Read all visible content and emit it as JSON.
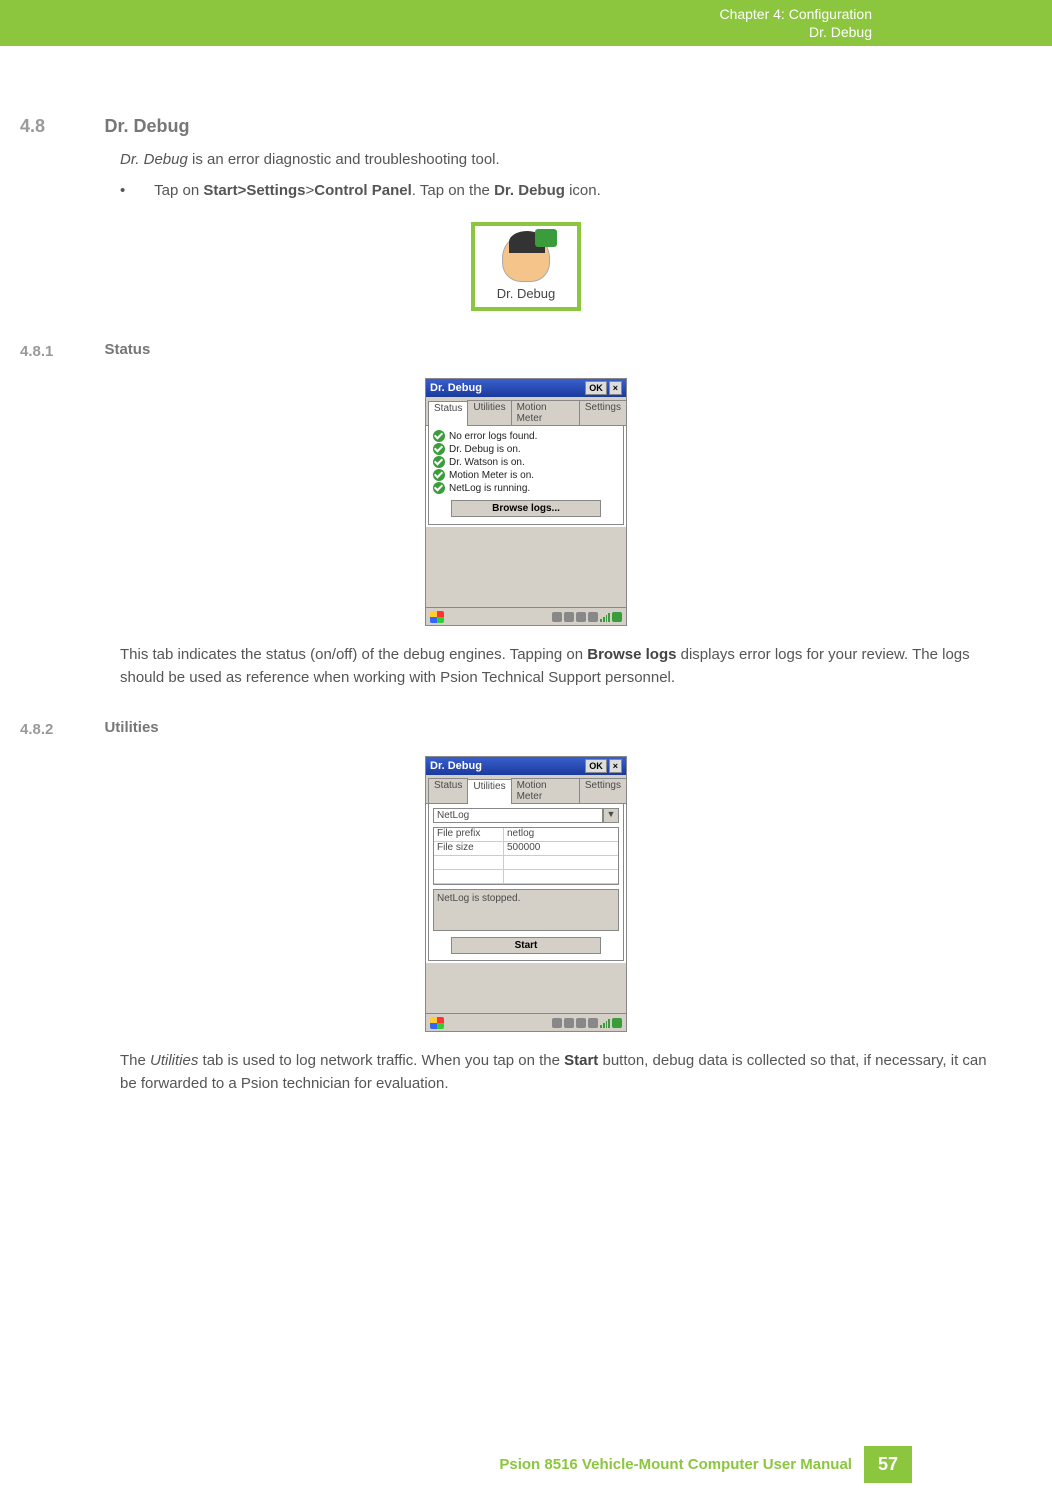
{
  "header": {
    "chapter": "Chapter 4:  Configuration",
    "subtitle": "Dr. Debug"
  },
  "sections": {
    "s48": {
      "num": "4.8",
      "title": "Dr. Debug"
    },
    "s481": {
      "num": "4.8.1",
      "title": "Status"
    },
    "s482": {
      "num": "4.8.2",
      "title": "Utilities"
    }
  },
  "intro": {
    "line1_em": "Dr. Debug",
    "line1_rest": " is an error diagnostic and troubleshooting tool.",
    "bullet_pre": "Tap on ",
    "bullet_b1": "Start>Settings",
    "bullet_mid": ">",
    "bullet_b2": "Control Panel",
    "bullet_post1": ". Tap on the ",
    "bullet_b3": "Dr. Debug",
    "bullet_post2": " icon."
  },
  "icon": {
    "label": "Dr. Debug"
  },
  "win_common": {
    "title": "Dr. Debug",
    "ok": "OK",
    "close": "×",
    "tabs": {
      "status": "Status",
      "utilities": "Utilities",
      "motion": "Motion Meter",
      "settings": "Settings"
    }
  },
  "status_win": {
    "items": [
      "No error logs found.",
      "Dr. Debug is on.",
      "Dr. Watson is on.",
      "Motion Meter is on.",
      "NetLog is running."
    ],
    "browse": "Browse logs..."
  },
  "status_para": {
    "p1": "This tab indicates the status (on/off) of the debug engines. Tapping on ",
    "b1": "Browse logs",
    "p2": " displays error logs for your review. The logs should be used as reference when working with Psion Technical Support personnel."
  },
  "util_win": {
    "dropdown": "NetLog",
    "rows": [
      {
        "k": "File prefix",
        "v": "netlog"
      },
      {
        "k": "File size",
        "v": "500000"
      }
    ],
    "msg": "NetLog is stopped.",
    "start": "Start"
  },
  "util_para": {
    "p1": "The ",
    "em1": "Utilities",
    "p2": " tab is used to log network traffic. When you tap on the ",
    "b1": "Start",
    "p3": " button, debug data is collected so that, if necessary, it can be forwarded to a Psion technician for evaluation."
  },
  "footer": {
    "manual": "Psion 8516 Vehicle-Mount Computer User Manual",
    "page": "57"
  }
}
